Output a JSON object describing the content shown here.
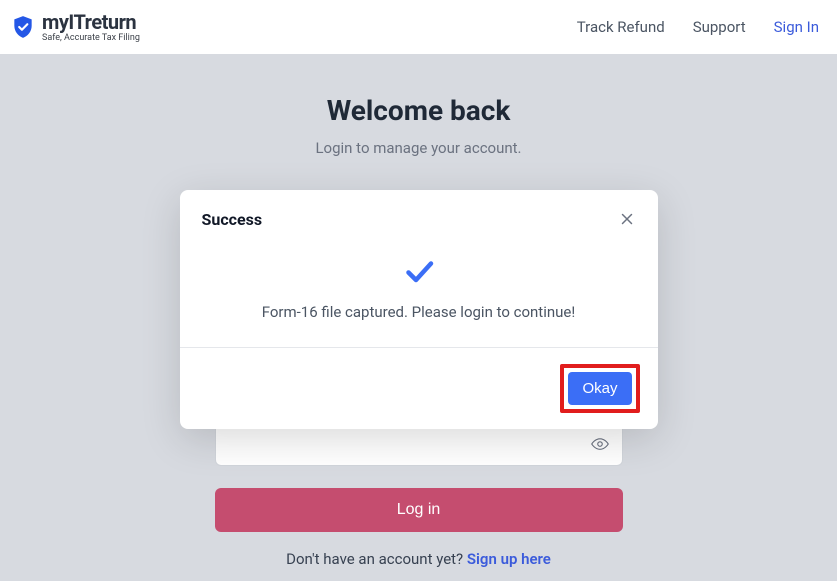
{
  "brand": {
    "name": "myITreturn",
    "tagline": "Safe, Accurate Tax Filing"
  },
  "nav": {
    "track": "Track Refund",
    "support": "Support",
    "signin": "Sign In"
  },
  "page": {
    "title": "Welcome back",
    "subtitle": "Login to manage your account."
  },
  "form": {
    "password_value": "",
    "login_label": "Log in"
  },
  "signup": {
    "prompt": "Don't have an account yet? ",
    "link": "Sign up here"
  },
  "modal": {
    "title": "Success",
    "message": "Form-16 file captured. Please login to continue!",
    "okay": "Okay"
  }
}
